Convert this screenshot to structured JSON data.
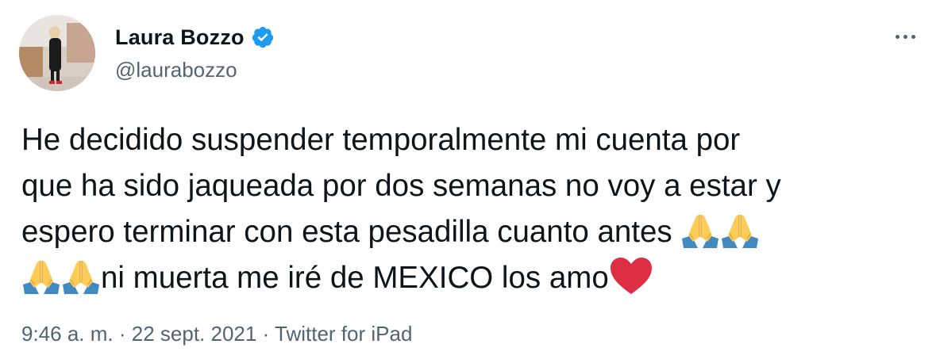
{
  "author": {
    "display_name": "Laura Bozzo",
    "handle": "@laurabozzo",
    "verified": true,
    "avatar_icon": "profile-photo",
    "verified_icon": "verified-badge-icon",
    "verified_color": "#1d9bf0"
  },
  "menu": {
    "more_icon": "more-options-icon"
  },
  "tweet": {
    "line1": "He decidido suspender temporalmente mi cuenta por",
    "line2": "que ha sido jaqueada por dos semanas no voy a estar y",
    "line3": "espero terminar con esta pesadilla cuanto antes ",
    "line4": "ni muerta me iré de MEXICO los amo",
    "emoji_pray": "folded-hands-emoji",
    "emoji_heart": "red-heart-emoji"
  },
  "meta": {
    "time": "9:46 a. m.",
    "separator": "·",
    "date": "22 sept. 2021",
    "source": "Twitter for iPad"
  },
  "colors": {
    "text": "#0f1419",
    "secondary": "#536471",
    "accent": "#1d9bf0"
  }
}
